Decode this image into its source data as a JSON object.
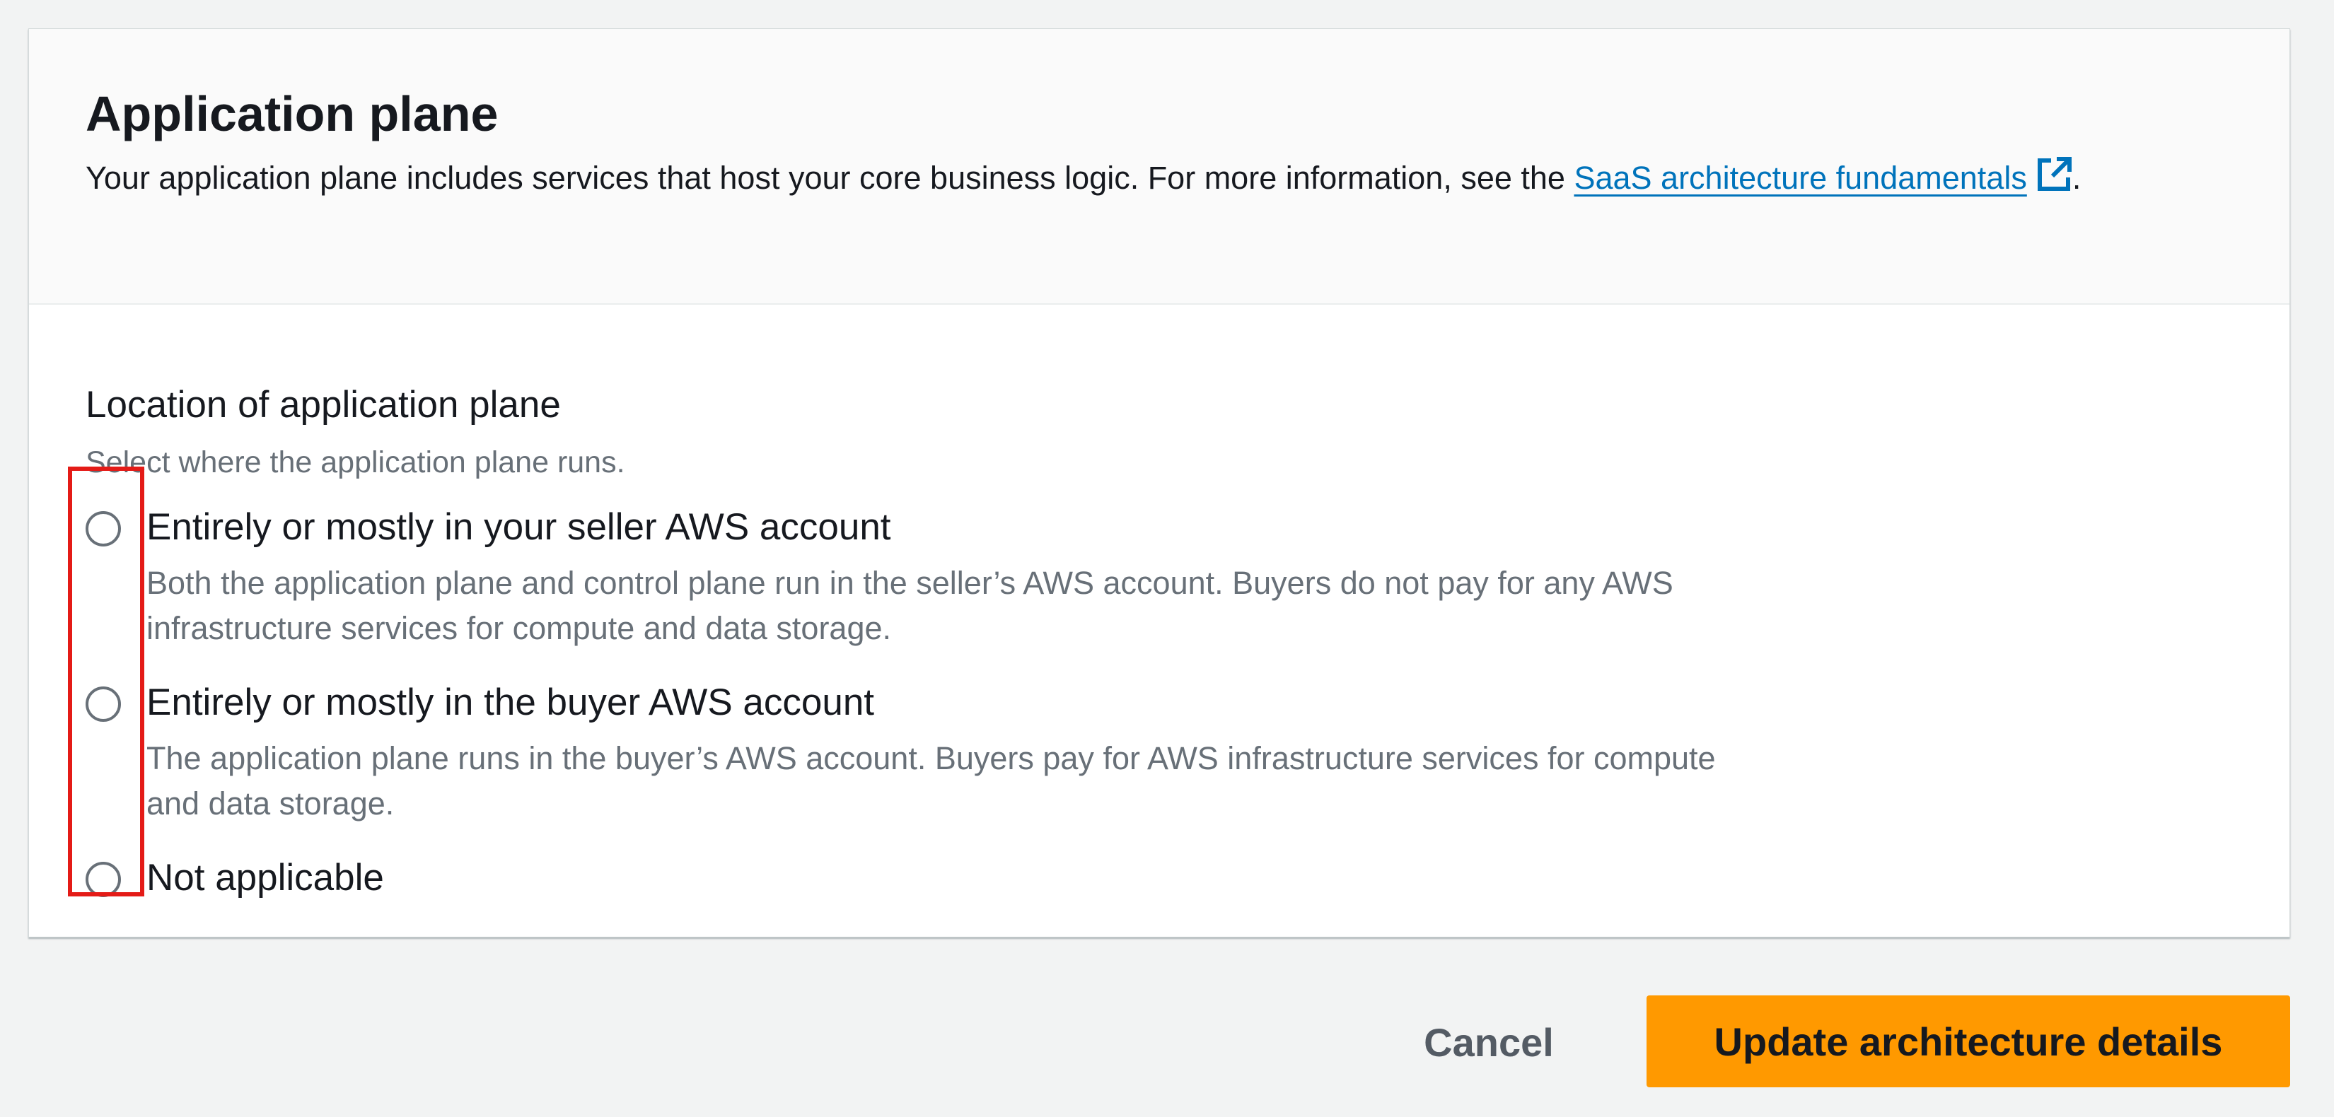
{
  "panel": {
    "title": "Application plane",
    "description_prefix": "Your application plane includes services that host your core business logic. For more information, see the ",
    "link_text": "SaaS architecture fundamentals",
    "description_suffix": ".",
    "link_color": "#0073bb"
  },
  "field": {
    "label": "Location of application plane",
    "description": "Select where the application plane runs.",
    "options": [
      {
        "label": "Entirely or mostly in your seller AWS account",
        "description": "Both the application plane and control plane run in the seller’s AWS account. Buyers do not pay for any AWS infrastructure services for compute and data storage.",
        "selected": false
      },
      {
        "label": "Entirely or mostly in the buyer AWS account",
        "description": "The application plane runs in the buyer’s AWS account. Buyers pay for AWS infrastructure services for compute and data storage.",
        "selected": false
      },
      {
        "label": "Not applicable",
        "description": "",
        "selected": false
      }
    ]
  },
  "actions": {
    "cancel_label": "Cancel",
    "submit_label": "Update architecture details",
    "primary_color": "#ff9900"
  },
  "annotation": {
    "highlight_color": "#e41b17"
  }
}
